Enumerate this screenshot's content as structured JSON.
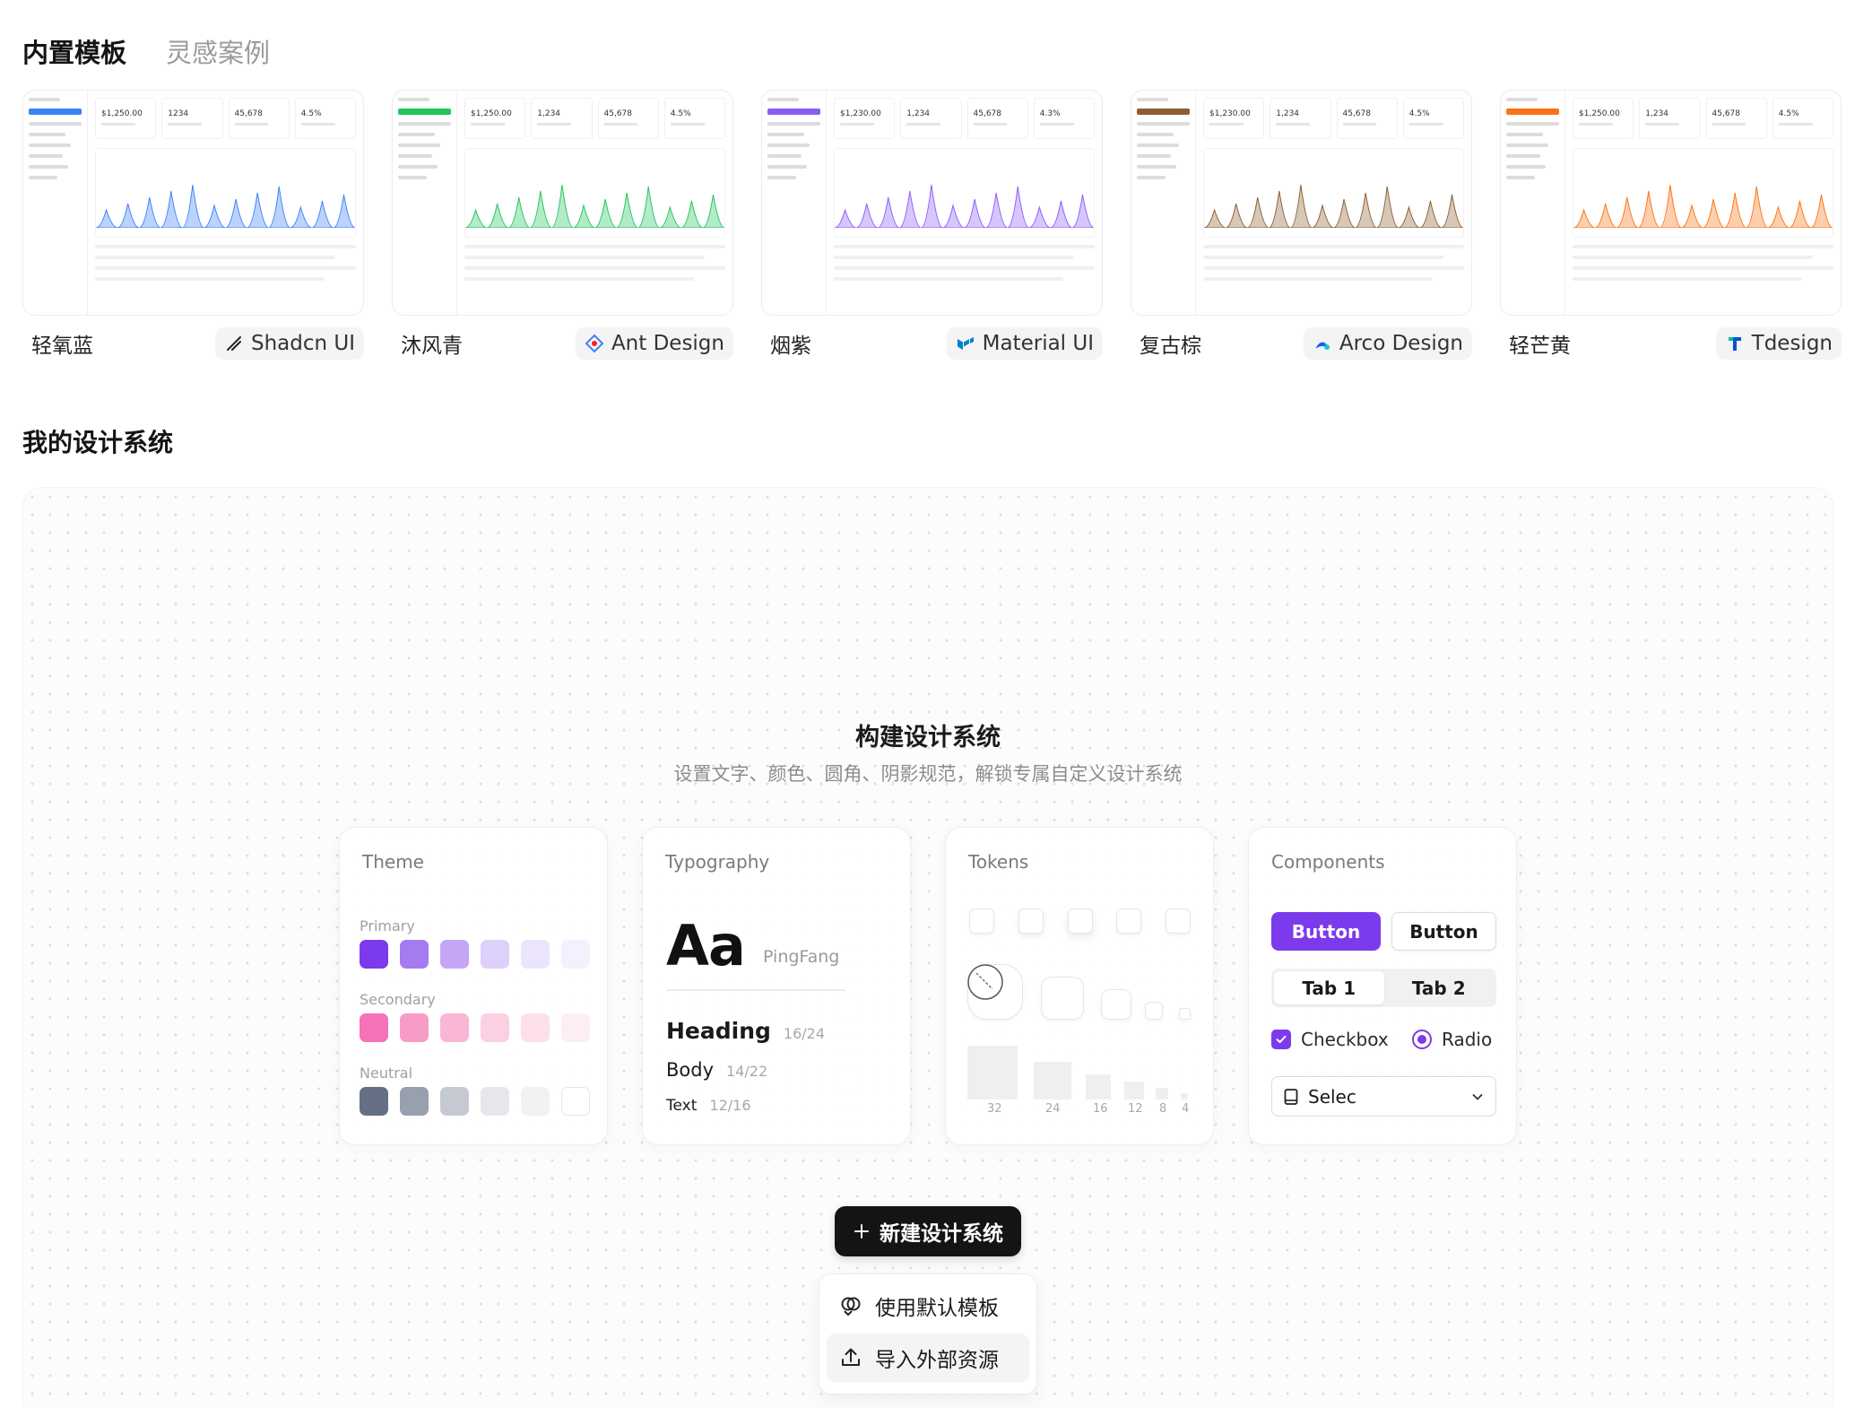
{
  "top_tabs": [
    "内置模板",
    "灵感案例"
  ],
  "templates": [
    {
      "name": "轻氧蓝",
      "badge": "Shadcn UI",
      "accent": "#3b82f6",
      "kpis": [
        "$1,250.00",
        "1234",
        "45,678",
        "4.5%"
      ]
    },
    {
      "name": "沐风青",
      "badge": "Ant Design",
      "accent": "#22c55e",
      "kpis": [
        "$1,250.00",
        "1,234",
        "45,678",
        "4.5%"
      ]
    },
    {
      "name": "烟紫",
      "badge": "Material UI",
      "accent": "#8b5cf6",
      "kpis": [
        "$1,230.00",
        "1,234",
        "45,678",
        "4.3%"
      ]
    },
    {
      "name": "复古棕",
      "badge": "Arco Design",
      "accent": "#8b5e34",
      "kpis": [
        "$1,230.00",
        "1,234",
        "45,678",
        "4.5%"
      ]
    },
    {
      "name": "轻芒黄",
      "badge": "Tdesign",
      "accent": "#f97316",
      "kpis": [
        "$1,250.00",
        "1,234",
        "45,678",
        "4.5%"
      ]
    }
  ],
  "section_title": "我的设计系统",
  "build": {
    "title": "构建设计系统",
    "subtitle": "设置文字、颜色、圆角、阴影规范，解锁专属自定义设计系统"
  },
  "theme_card": {
    "title": "Theme",
    "groups": [
      {
        "label": "Primary",
        "colors": [
          "#7c3aed",
          "#a47bf0",
          "#c4a6f5",
          "#ddd0fa",
          "#ebe4fc",
          "#f4f0fd"
        ]
      },
      {
        "label": "Secondary",
        "colors": [
          "#f472b6",
          "#f79bc7",
          "#f9b7d5",
          "#fbd0e2",
          "#fde0ec",
          "#fdeef4"
        ]
      },
      {
        "label": "Neutral",
        "colors": [
          "#667085",
          "#98a0b0",
          "#c5c9d2",
          "#e5e7eb",
          "#f1f2f4",
          "#ffffff"
        ]
      }
    ]
  },
  "typography_card": {
    "title": "Typography",
    "sample": "Aa",
    "font": "PingFang",
    "rows": [
      {
        "name": "Heading",
        "size": "16/24"
      },
      {
        "name": "Body",
        "size": "14/22"
      },
      {
        "name": "Text",
        "size": "12/16"
      }
    ]
  },
  "tokens_card": {
    "title": "Tokens",
    "sizes": [
      "32",
      "24",
      "16",
      "12",
      "8",
      "4"
    ]
  },
  "components_card": {
    "title": "Components",
    "primary_button": "Button",
    "secondary_button": "Button",
    "tabs": [
      "Tab 1",
      "Tab 2"
    ],
    "checkbox": "Checkbox",
    "radio": "Radio",
    "select": "Selec"
  },
  "new_button": "新建设计系统",
  "menu": {
    "use_default": "使用默认模板",
    "import_external": "导入外部资源"
  }
}
